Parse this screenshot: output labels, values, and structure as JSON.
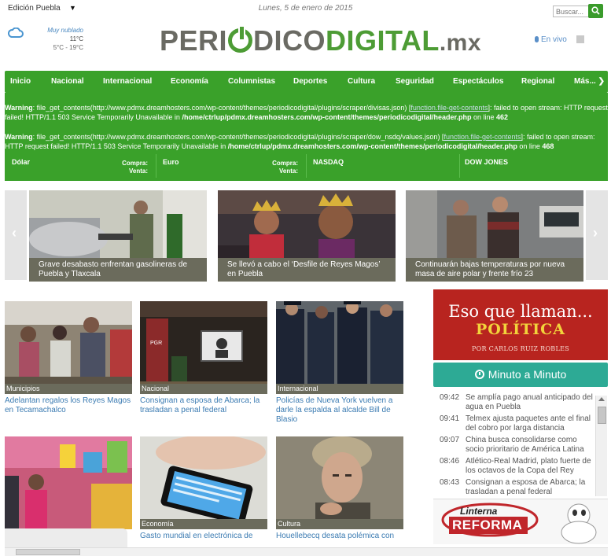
{
  "topbar": {
    "edition": "Edición Puebla",
    "date": "Lunes, 5 de enero de 2015",
    "search_placeholder": "Buscar..."
  },
  "weather": {
    "condition": "Muy nublado",
    "temp": "11°C",
    "range": "5°C - 19°C"
  },
  "logo": {
    "part1": "PERI",
    "part2": "DICO",
    "part3": "DIGITAL",
    "part4": ".mx"
  },
  "envivo": "En vivo",
  "nav": {
    "items": [
      "Inicio",
      "Nacional",
      "Internacional",
      "Economía",
      "Columnistas",
      "Deportes",
      "Cultura",
      "Seguridad",
      "Espectáculos",
      "Regional"
    ],
    "more": "Más..."
  },
  "warnings": [
    {
      "label": "Warning",
      "text1": ": file_get_contents(http://www.pdmx.dreamhosters.com/wp-content/themes/periodicodigital/plugins/scraper/divisas.json) [",
      "link": "function.file-get-contents",
      "text2": "]: failed to open stream: HTTP request failed! HTTP/1.1 503 Service Temporarily Unavailable in ",
      "path": "/home/ctrlup/pdmx.dreamhosters.com/wp-content/themes/periodicodigital/header.php",
      "online": " on line ",
      "line": "462"
    },
    {
      "label": "Warning",
      "text1": ": file_get_contents(http://www.pdmx.dreamhosters.com/wp-content/themes/periodicodigital/plugins/scraper/dow_nsdq/values.json) [",
      "link": "function.file-get-contents",
      "text2": "]: failed to open stream: HTTP request failed! HTTP/1.1 503 Service Temporarily Unavailable in ",
      "path": "/home/ctrlup/pdmx.dreamhosters.com/wp-content/themes/periodicodigital/header.php",
      "online": " on line ",
      "line": "468"
    }
  ],
  "fx": {
    "dolar": "Dólar",
    "euro": "Euro",
    "nasdaq": "NASDAQ",
    "dow": "DOW JONES",
    "compra": "Compra:",
    "venta": "Venta:"
  },
  "slides": [
    {
      "caption": "Grave desabasto enfrentan gasolineras de Puebla y Tlaxcala"
    },
    {
      "caption": "Se llevó a cabo el ‘Desfile de Reyes Magos’ en Puebla"
    },
    {
      "caption": "Continuarán bajas temperaturas por nueva masa de aire polar y frente frío 23"
    }
  ],
  "tiles": [
    {
      "category": "Municipios",
      "title": "Adelantan regalos los Reyes Magos en Tecamachalco"
    },
    {
      "category": "Nacional",
      "title": "Consignan a esposa de Abarca; la trasladan a penal federal"
    },
    {
      "category": "Internacional",
      "title": "Policías de Nueva York vuelven a darle la espalda al alcalde Bill de Blasio"
    },
    {
      "category": "",
      "title": ""
    },
    {
      "category": "Economía",
      "title": "Gasto mundial en electrónica de"
    },
    {
      "category": "Cultura",
      "title": "Houellebecq desata polémica con"
    }
  ],
  "tile_decor": {
    "pgr": "PGR"
  },
  "banner": {
    "line1": "Eso que llaman...",
    "line2": "POLÍTICA",
    "line3": "POR CARLOS RUIZ ROBLES"
  },
  "minuto": {
    "title": "Minuto a Minuto",
    "items": [
      {
        "time": "09:42",
        "headline": "Se amplía pago anual anticipado del agua en Puebla"
      },
      {
        "time": "09:41",
        "headline": "Telmex ajusta paquetes ante el final del cobro por larga distancia"
      },
      {
        "time": "09:07",
        "headline": "China busca consolidarse como socio prioritario de América Latina"
      },
      {
        "time": "08:46",
        "headline": "Atlético-Real Madrid, plato fuerte de los octavos de la Copa del Rey"
      },
      {
        "time": "08:43",
        "headline": "Consignan a esposa de Abarca; la trasladan a penal federal"
      }
    ]
  },
  "linterna": {
    "top": "Linterna",
    "bottom": "REFORMA"
  },
  "colors": {
    "green": "#3aa12a",
    "caption_bg": "#6b6b5c",
    "link_blue": "#3b7bb2",
    "banner_red": "#b8241f",
    "teal": "#2daa95"
  }
}
